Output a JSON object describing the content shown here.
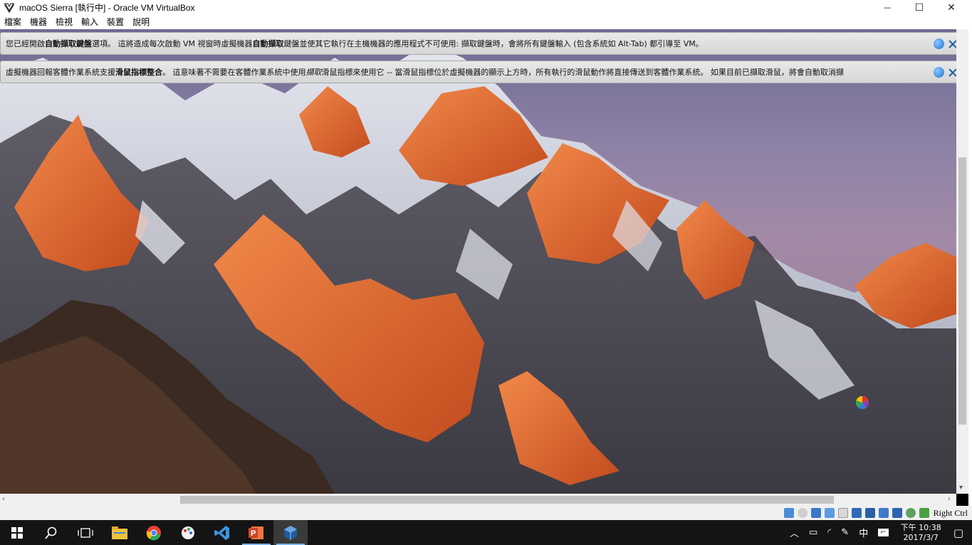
{
  "window": {
    "title": "macOS Sierra [執行中] - Oracle VM VirtualBox",
    "minimize_label": "—",
    "maximize_label": "☐",
    "close_label": "✕"
  },
  "menu": {
    "items": [
      "檔案",
      "機器",
      "檢視",
      "輸入",
      "裝置",
      "說明"
    ]
  },
  "banners": [
    {
      "segments": [
        {
          "t": "您已經開啟"
        },
        {
          "t": "自動擷取鍵盤",
          "b": true
        },
        {
          "t": "選項。 這將造成每次啟動 VM 視窗時虛擬機器"
        },
        {
          "t": "自動擷取",
          "b": true
        },
        {
          "t": "鍵盤並使其它執行在主機機器的應用程式不可使用: 擷取鍵盤時，會將所有鍵盤輸入 (包含系統如 Alt-Tab) 都引導至 VM。"
        }
      ]
    },
    {
      "segments": [
        {
          "t": "虛擬機器回報客體作業系統支援"
        },
        {
          "t": "滑鼠指標整合",
          "b": true
        },
        {
          "t": "。 這意味著不需要在客體作業系統中使用"
        },
        {
          "t": "擷取",
          "i": true
        },
        {
          "t": "滑鼠指標來使用它 -- 當滑鼠指標位於虛擬機器的顯示上方時，所有執行的滑鼠動作將直接傳送到客體作業系統。 如果目前已擷取滑鼠，將會自動取消擷"
        }
      ]
    }
  ],
  "statusbar": {
    "host_key": "Right Ctrl",
    "icons": [
      "hard-disk-icon",
      "optical-drive-icon",
      "audio-icon",
      "network-icon",
      "usb-icon",
      "shared-folder-icon",
      "display-icon",
      "video-capture-icon",
      "vt-x-icon",
      "mouse-integration-icon",
      "keyboard-capture-icon"
    ]
  },
  "taskbar": {
    "apps": [
      "start-icon",
      "search-icon",
      "task-view-icon",
      "file-explorer-icon",
      "chrome-icon",
      "paint-icon",
      "visual-studio-code-icon",
      "powerpoint-icon",
      "virtualbox-icon"
    ],
    "ime": "中",
    "time": "下午 10:38",
    "date": "2017/3/7"
  },
  "colors": {
    "taskbar": "#141414",
    "sky_top": "#6f6a92",
    "peaks": "#e8733a"
  }
}
